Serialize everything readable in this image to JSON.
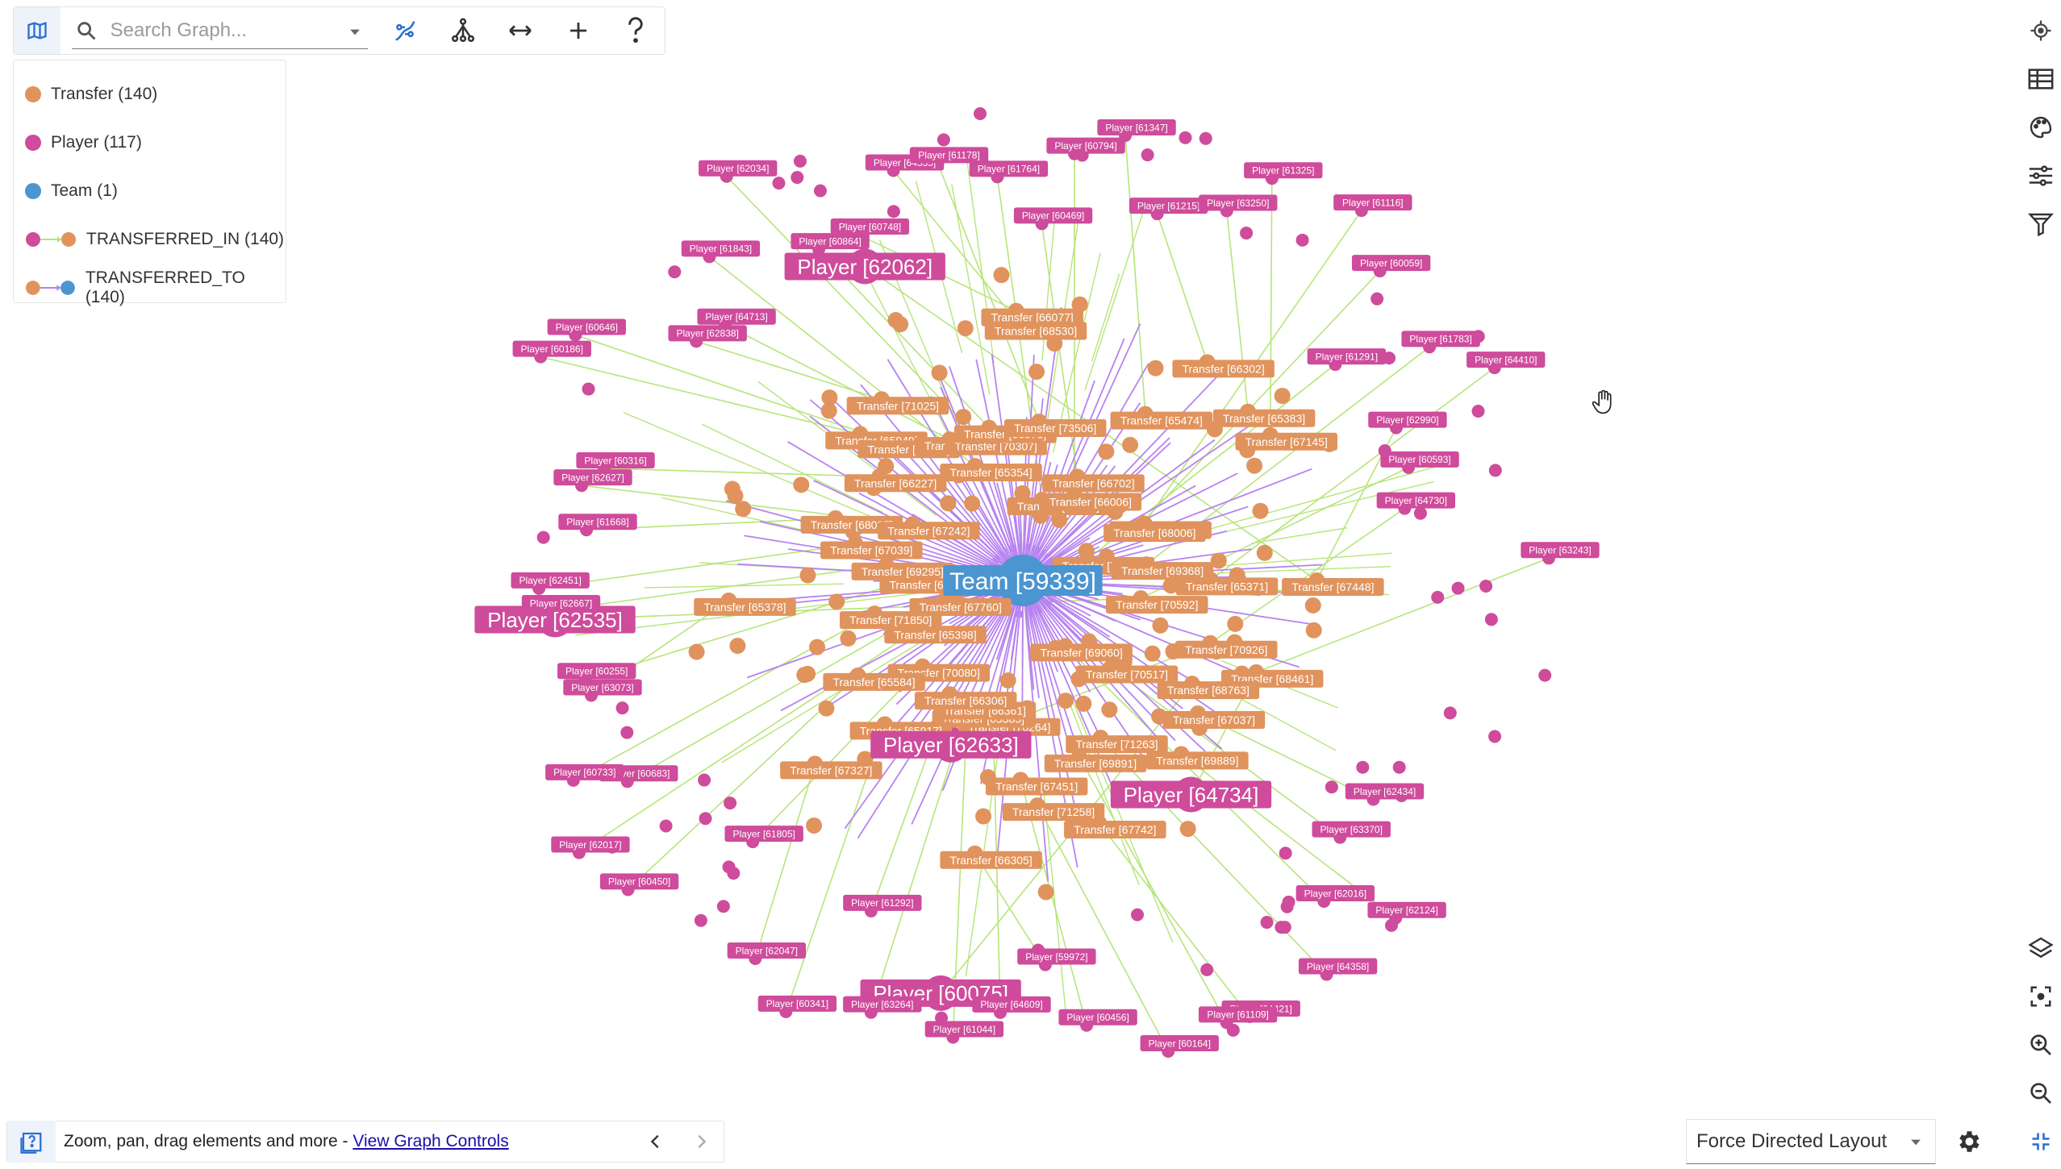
{
  "toolbar": {
    "search_placeholder": "Search Graph...",
    "icons": [
      "map-icon",
      "search-icon",
      "chevron-down-icon",
      "path-icon",
      "hierarchy-icon",
      "expand-arrows-icon",
      "add-icon",
      "help-icon"
    ]
  },
  "legend": {
    "items": [
      {
        "label": "Transfer (140)",
        "color": "#e0935d",
        "kind": "node"
      },
      {
        "label": "Player (117)",
        "color": "#cf4b9b",
        "kind": "node"
      },
      {
        "label": "Team (1)",
        "color": "#4b95d1",
        "kind": "node"
      },
      {
        "label": "TRANSFERRED_IN (140)",
        "from": "#cf4b9b",
        "to": "#e0935d",
        "line": "#b6e57a",
        "kind": "rel"
      },
      {
        "label": "TRANSFERRED_TO (140)",
        "from": "#e0935d",
        "to": "#4b95d1",
        "line": "#b882f0",
        "kind": "rel"
      }
    ]
  },
  "right_rail_top": [
    "locate-icon",
    "table-icon",
    "palette-icon",
    "sliders-icon",
    "filter-icon"
  ],
  "right_rail_bottom": [
    "layers-icon",
    "focus-icon",
    "zoom-in-icon",
    "zoom-out-icon",
    "fit-screen-icon"
  ],
  "bottom_bar": {
    "text": "Zoom, pan, drag elements and more - ",
    "link": "View Graph Controls"
  },
  "layout_select": {
    "value": "Force Directed Layout"
  },
  "colors": {
    "player": "#cf4b9b",
    "transfer": "#e0935d",
    "team": "#4b95d1",
    "transferred_in_edge": "#b6e57a",
    "transferred_to_edge": "#b882f0"
  },
  "graph": {
    "center_label": "Team [59339]",
    "players": [
      {
        "label": "Player [62062]",
        "big": true
      },
      {
        "label": "Player [62535]",
        "big": true
      },
      {
        "label": "Player [62633]",
        "big": true
      },
      {
        "label": "Player [64734]",
        "big": true
      },
      {
        "label": "Player [60075]",
        "big": true
      },
      {
        "label": "Player [62434]"
      },
      {
        "label": "Player [63370]"
      },
      {
        "label": "Player [62124]"
      },
      {
        "label": "Player [62016]"
      },
      {
        "label": "Player [64358]"
      },
      {
        "label": "Player [64421]"
      },
      {
        "label": "Player [61109]"
      },
      {
        "label": "Player [60164]"
      },
      {
        "label": "Player [60456]"
      },
      {
        "label": "Player [59972]"
      },
      {
        "label": "Player [64609]"
      },
      {
        "label": "Player [61044]"
      },
      {
        "label": "Player [63264]"
      },
      {
        "label": "Player [61292]"
      },
      {
        "label": "Player [60341]"
      },
      {
        "label": "Player [62047]"
      },
      {
        "label": "Player [61805]"
      },
      {
        "label": "Player [60450]"
      },
      {
        "label": "Player [62017]"
      },
      {
        "label": "Player [60683]"
      },
      {
        "label": "Player [60733]"
      },
      {
        "label": "Player [63073]"
      },
      {
        "label": "Player [60255]"
      },
      {
        "label": "Player [62667]"
      },
      {
        "label": "Player [62451]"
      },
      {
        "label": "Player [61668]"
      },
      {
        "label": "Player [62627]"
      },
      {
        "label": "Player [60316]"
      },
      {
        "label": "Player [60186]"
      },
      {
        "label": "Player [60646]"
      },
      {
        "label": "Player [62838]"
      },
      {
        "label": "Player [64713]"
      },
      {
        "label": "Player [61843]"
      },
      {
        "label": "Player [62034]"
      },
      {
        "label": "Player [60864]"
      },
      {
        "label": "Player [60748]"
      },
      {
        "label": "Player [64555]"
      },
      {
        "label": "Player [61178]"
      },
      {
        "label": "Player [61764]"
      },
      {
        "label": "Player [60469]"
      },
      {
        "label": "Player [60794]"
      },
      {
        "label": "Player [61347]"
      },
      {
        "label": "Player [61215]"
      },
      {
        "label": "Player [63250]"
      },
      {
        "label": "Player [61325]"
      },
      {
        "label": "Player [61116]"
      },
      {
        "label": "Player [60059]"
      },
      {
        "label": "Player [61291]"
      },
      {
        "label": "Player [61783]"
      },
      {
        "label": "Player [64410]"
      },
      {
        "label": "Player [62990]"
      },
      {
        "label": "Player [60593]"
      },
      {
        "label": "Player [64730]"
      },
      {
        "label": "Player [63243]"
      }
    ],
    "transfers": [
      "Transfer [67448]",
      "Transfer [70592]",
      "Transfer [70926]",
      "Transfer [68461]",
      "Transfer [68763]",
      "Transfer [67037]",
      "Transfer [70517]",
      "Transfer [69889]",
      "Transfer [69060]",
      "Transfer [71263]",
      "Transfer [67742]",
      "Transfer [69891]",
      "Transfer [71258]",
      "Transfer [67451]",
      "Transfer [66305]",
      "Transfer [70264]",
      "Transfer [65385]",
      "Transfer [66361]",
      "Transfer [66306]",
      "Transfer [65917]",
      "Transfer [67327]",
      "Transfer [70080]",
      "Transfer [65584]",
      "Transfer [65398]",
      "Transfer [67760]",
      "Transfer [71850]",
      "Transfer [65378]",
      "Transfer [66720]",
      "Transfer [69295]",
      "Transfer [67039]",
      "Transfer [68097]",
      "Transfer [67242]",
      "Transfer [66227]",
      "Transfer [65949]",
      "Transfer [65352]",
      "Transfer [71025]",
      "Transfer [65065]",
      "Transfer [65354]",
      "Transfer [70307]",
      "Transfer [66871]",
      "Transfer [66077]",
      "Transfer [68530]",
      "Transfer [73506]",
      "Transfer [64926]",
      "Transfer [66702]",
      "Transfer [66006]",
      "Transfer [65474]",
      "Transfer [66302]",
      "Transfer [65383]",
      "Transfer [67145]",
      "Transfer [67241]",
      "Transfer [68006]",
      "Transfer [74222]",
      "Transfer [69368]",
      "Transfer [65371]"
    ]
  }
}
